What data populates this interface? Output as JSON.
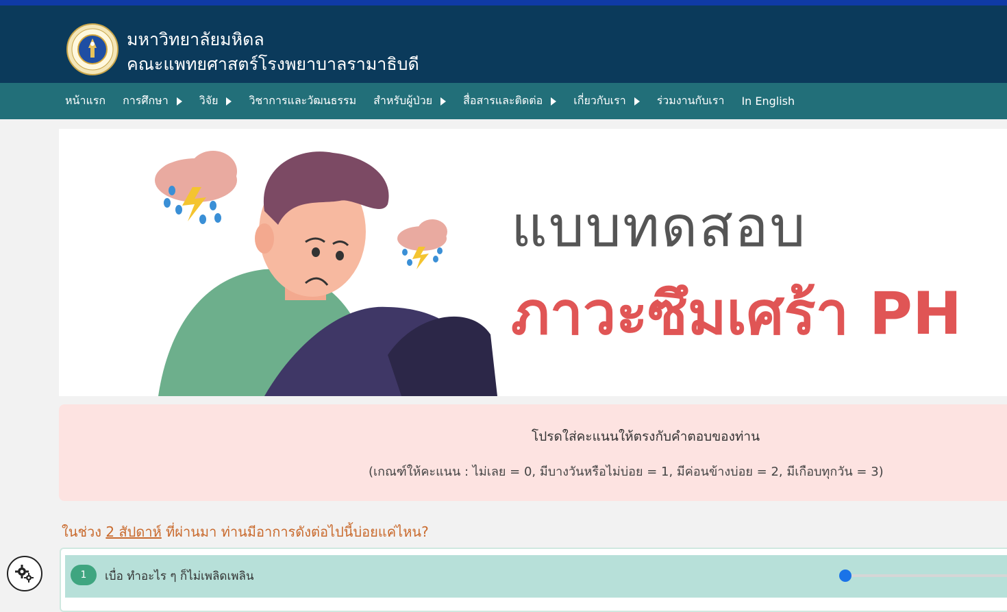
{
  "header": {
    "university": "มหาวิทยาลัยมหิดล",
    "faculty": "คณะแพทยศาสตร์โรงพยาบาลรามาธิบดี"
  },
  "nav": {
    "items": [
      {
        "label": "หน้าแรก",
        "has_submenu": false
      },
      {
        "label": "การศึกษา",
        "has_submenu": true
      },
      {
        "label": "วิจัย",
        "has_submenu": true
      },
      {
        "label": "วิชาการและวัฒนธรรม",
        "has_submenu": false
      },
      {
        "label": "สำหรับผู้ป่วย",
        "has_submenu": true
      },
      {
        "label": "สื่อสารและติดต่อ",
        "has_submenu": true
      },
      {
        "label": "เกี่ยวกับเรา",
        "has_submenu": true
      },
      {
        "label": "ร่วมงานกับเรา",
        "has_submenu": false
      },
      {
        "label": "In English",
        "has_submenu": false
      }
    ]
  },
  "banner": {
    "line1": "แบบทดสอบ",
    "line2": "ภาวะซึมเศร้า PH"
  },
  "notice": {
    "title": "โปรดใส่คะแนนให้ตรงกับคำตอบของท่าน",
    "criteria": "(เกณฑ์ให้คะแนน : ไม่เลย = 0, มีบางวันหรือไม่บ่อย = 1, มีค่อนข้างบ่อย = 2, มีเกือบทุกวัน = 3)"
  },
  "question_header": {
    "prefix": "ในช่วง ",
    "emphasis": "2 สัปดาห์",
    "suffix": " ที่ผ่านมา ท่านมีอาการดังต่อไปนี้บ่อยแค่ไหน?"
  },
  "questions": [
    {
      "number": "1",
      "text": "เบื่อ ทำอะไร ๆ ก็ไม่เพลิดเพลิน",
      "score": 0
    }
  ],
  "icons": {
    "logo": "university-seal-icon",
    "settings": "gear-icon"
  },
  "colors": {
    "header": "#0b3a5b",
    "nav": "#226f79",
    "accent_red": "#e05555",
    "question_orange": "#c96a2d",
    "row_green": "#b7e0d9"
  }
}
